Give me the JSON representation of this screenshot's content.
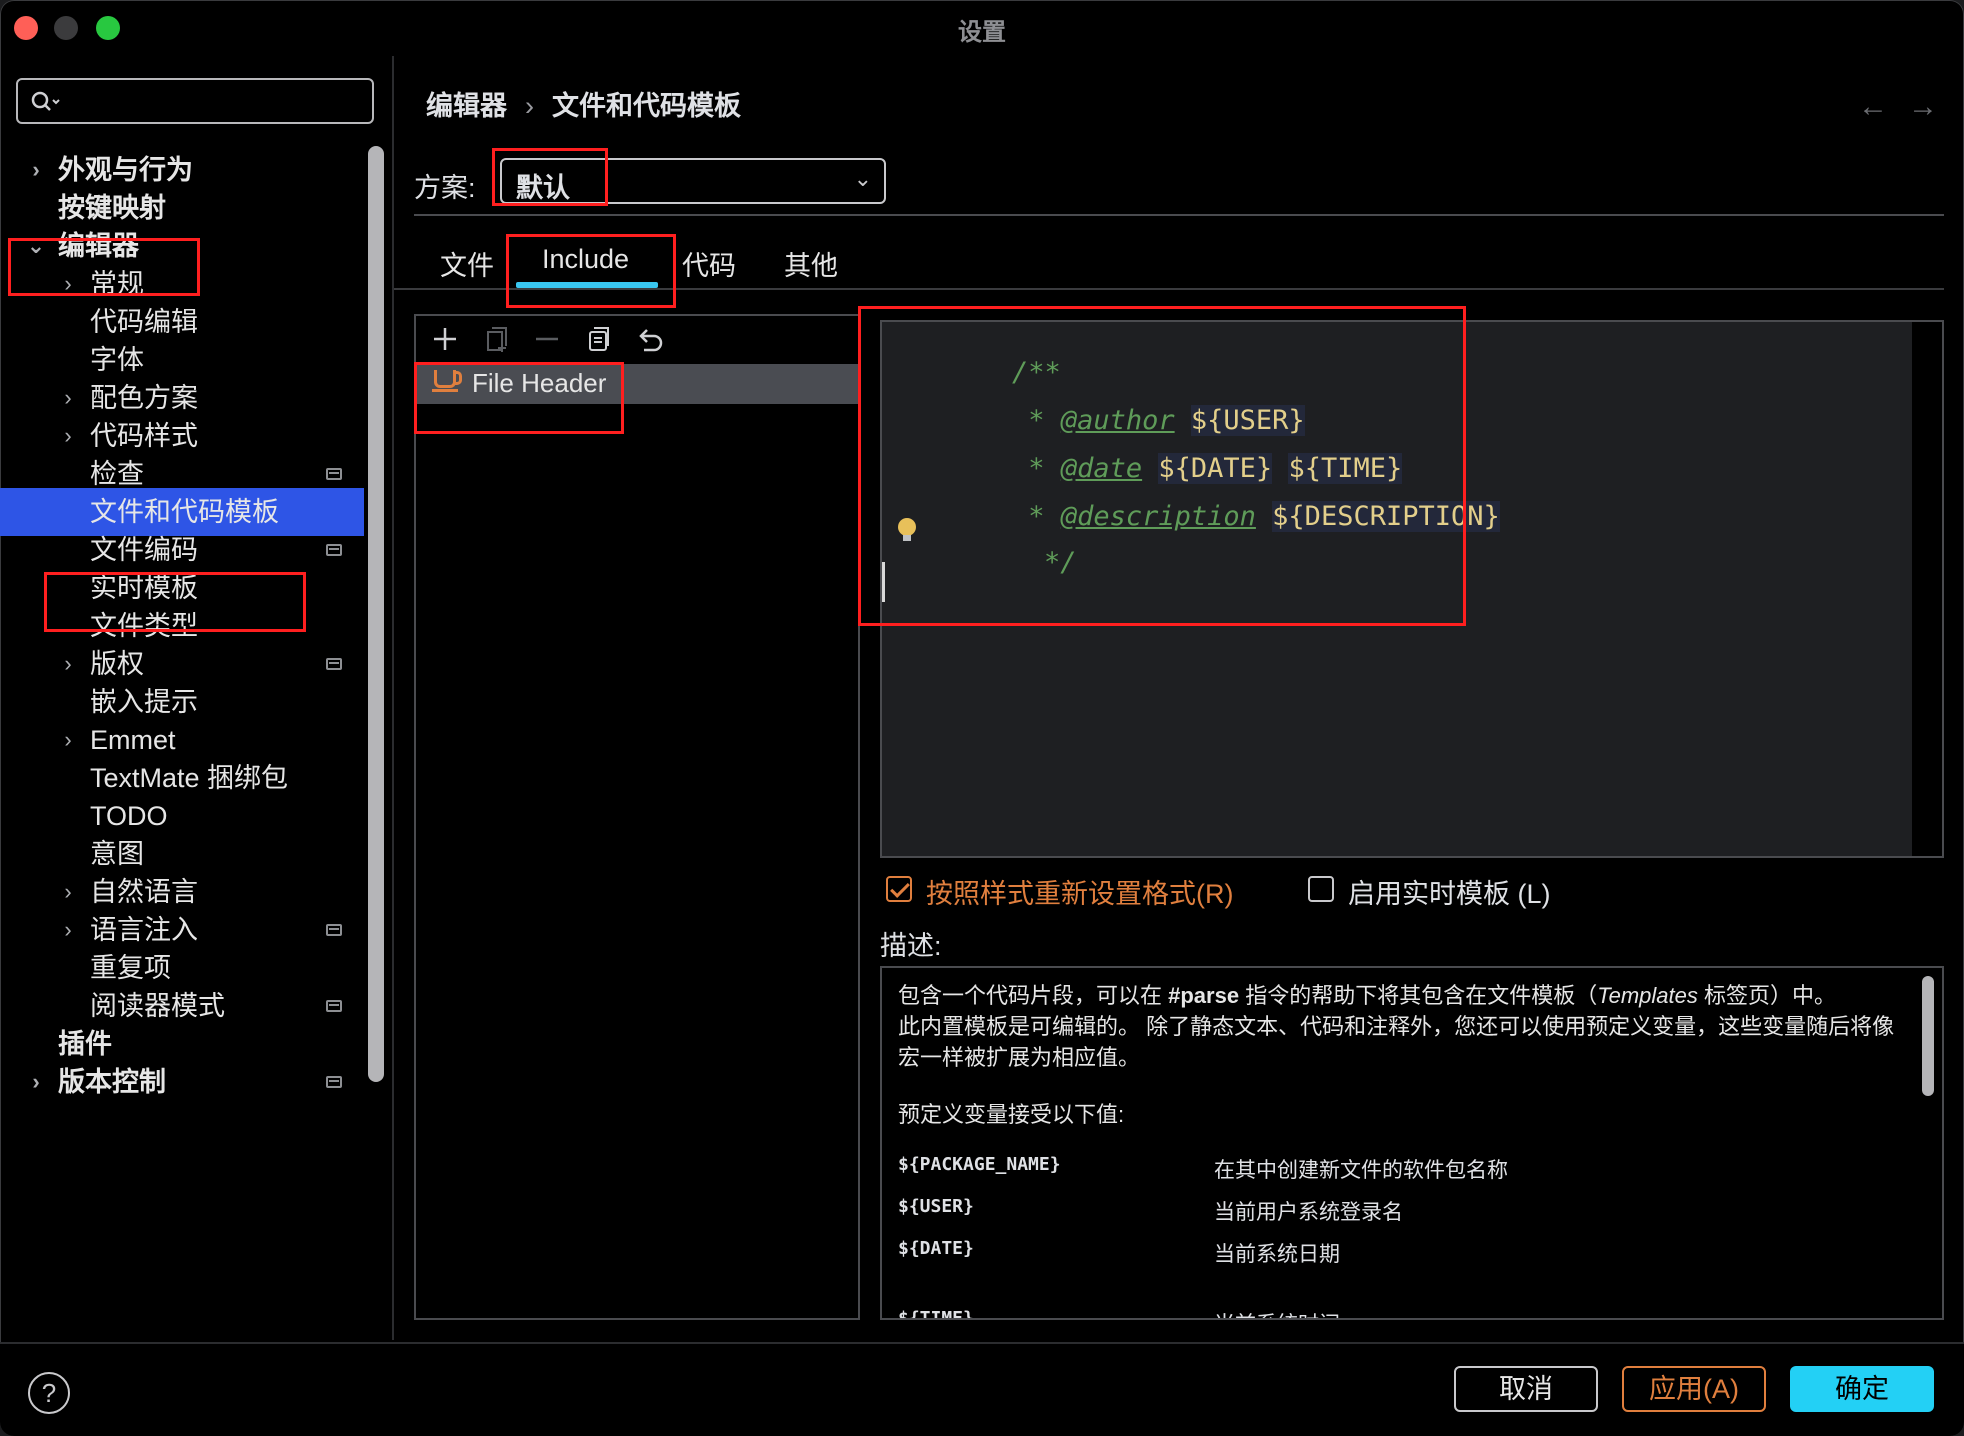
{
  "window": {
    "title": "设置"
  },
  "sidebar": {
    "search_placeholder": "",
    "items": [
      {
        "label": "外观与行为"
      },
      {
        "label": "按键映射"
      },
      {
        "label": "编辑器"
      },
      {
        "label": "常规"
      },
      {
        "label": "代码编辑"
      },
      {
        "label": "字体"
      },
      {
        "label": "配色方案"
      },
      {
        "label": "代码样式"
      },
      {
        "label": "检查"
      },
      {
        "label": "文件和代码模板"
      },
      {
        "label": "文件编码"
      },
      {
        "label": "实时模板"
      },
      {
        "label": "文件类型"
      },
      {
        "label": "版权"
      },
      {
        "label": "嵌入提示"
      },
      {
        "label": "Emmet"
      },
      {
        "label": "TextMate 捆绑包"
      },
      {
        "label": "TODO"
      },
      {
        "label": "意图"
      },
      {
        "label": "自然语言"
      },
      {
        "label": "语言注入"
      },
      {
        "label": "重复项"
      },
      {
        "label": "阅读器模式"
      },
      {
        "label": "插件"
      },
      {
        "label": "版本控制"
      }
    ]
  },
  "breadcrumb": {
    "parent": "编辑器",
    "separator": "›",
    "current": "文件和代码模板"
  },
  "nav": {
    "back": "←",
    "forward": "→"
  },
  "scheme": {
    "label": "方案:",
    "value": "默认"
  },
  "tabs": [
    {
      "label": "文件"
    },
    {
      "label": "Include"
    },
    {
      "label": "代码"
    },
    {
      "label": "其他"
    }
  ],
  "active_tab": "Include",
  "template_list": {
    "toolbar": [
      "add-icon",
      "copy-icon",
      "remove-icon",
      "reset-icon",
      "undo-icon"
    ],
    "items": [
      {
        "label": "File Header"
      }
    ]
  },
  "editor": {
    "lines": [
      {
        "comment": "/**"
      },
      {
        "prefix": " * ",
        "tag": "@author",
        "vars": [
          "${USER}"
        ]
      },
      {
        "prefix": " * ",
        "tag": "@date",
        "vars": [
          "${DATE}",
          "${TIME}"
        ]
      },
      {
        "prefix": " * ",
        "tag": "@description",
        "vars": [
          "${DESCRIPTION}"
        ]
      },
      {
        "comment": "*/"
      }
    ]
  },
  "options": {
    "reformat_label": "按照样式重新设置格式(R)",
    "reformat_checked": true,
    "live_template_label": "启用实时模板 (L)",
    "live_template_checked": false
  },
  "description": {
    "label": "描述:",
    "para1_a": "包含一个代码片段，可以在 ",
    "para1_b": "#parse",
    "para1_c": " 指令的帮助下将其包含在文件模板（",
    "para1_d": "Templates",
    "para1_e": " 标签页）中。",
    "para2": "此内置模板是可编辑的。 除了静态文本、代码和注释外，您还可以使用预定义变量，这些变量随后将像宏一样被扩展为相应值。",
    "para3": "预定义变量接受以下值:",
    "vars": [
      {
        "name": "${PACKAGE_NAME}",
        "desc": "在其中创建新文件的软件包名称"
      },
      {
        "name": "${USER}",
        "desc": "当前用户系统登录名"
      },
      {
        "name": "${DATE}",
        "desc": "当前系统日期"
      },
      {
        "name": "${TIME}",
        "desc": "当前系统时间"
      }
    ]
  },
  "footer": {
    "help": "?",
    "cancel": "取消",
    "apply": "应用(A)",
    "ok": "确定"
  },
  "colors": {
    "selection": "#2e55e6",
    "accent_orange": "#e07f3e",
    "primary_button": "#23d0f5",
    "tab_underline": "#39c6f0",
    "annotation_red": "#ff1f1f"
  }
}
